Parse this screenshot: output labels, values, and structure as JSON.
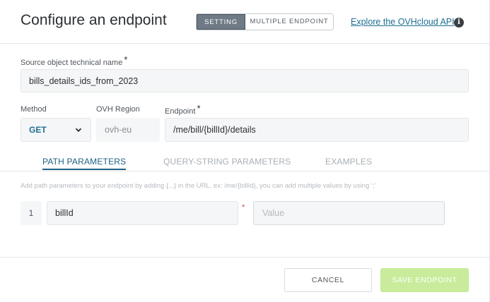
{
  "dialog": {
    "title": "Configure an endpoint",
    "modes": [
      "SETTING",
      "MULTIPLE ENDPOINT"
    ],
    "active_mode": "SETTING",
    "api_link": "Explore the OVHcloud API",
    "info_icon": "i"
  },
  "form": {
    "source_label": "Source object technical name",
    "source_value": "bills_details_ids_from_2023",
    "required_mark": "*",
    "method_label": "Method",
    "method_value": "GET",
    "region_label": "OVH Region",
    "region_value": "ovh-eu",
    "endpoint_label": "Endpoint",
    "endpoint_value": "/me/bill/{billId}/details"
  },
  "tabs": {
    "items": [
      "PATH PARAMETERS",
      "QUERY-STRING PARAMETERS",
      "EXAMPLES"
    ],
    "active": "PATH PARAMETERS"
  },
  "path_params": {
    "hint": "Add path parameters to your endpoint by adding {...} in the URL. ex: /me/{billId}, you can add multiple values by using ';'",
    "rows": [
      {
        "index": "1",
        "name": "billId",
        "required_mark": "*",
        "value_placeholder": "Value"
      }
    ]
  },
  "footer": {
    "cancel_label": "CANCEL",
    "save_label": "SAVE ENDPOINT"
  },
  "colors": {
    "accent": "#1c5f82",
    "link": "#1c6f92",
    "save_disabled": "#c9ec9c",
    "segment_active": "#6f7a86"
  }
}
